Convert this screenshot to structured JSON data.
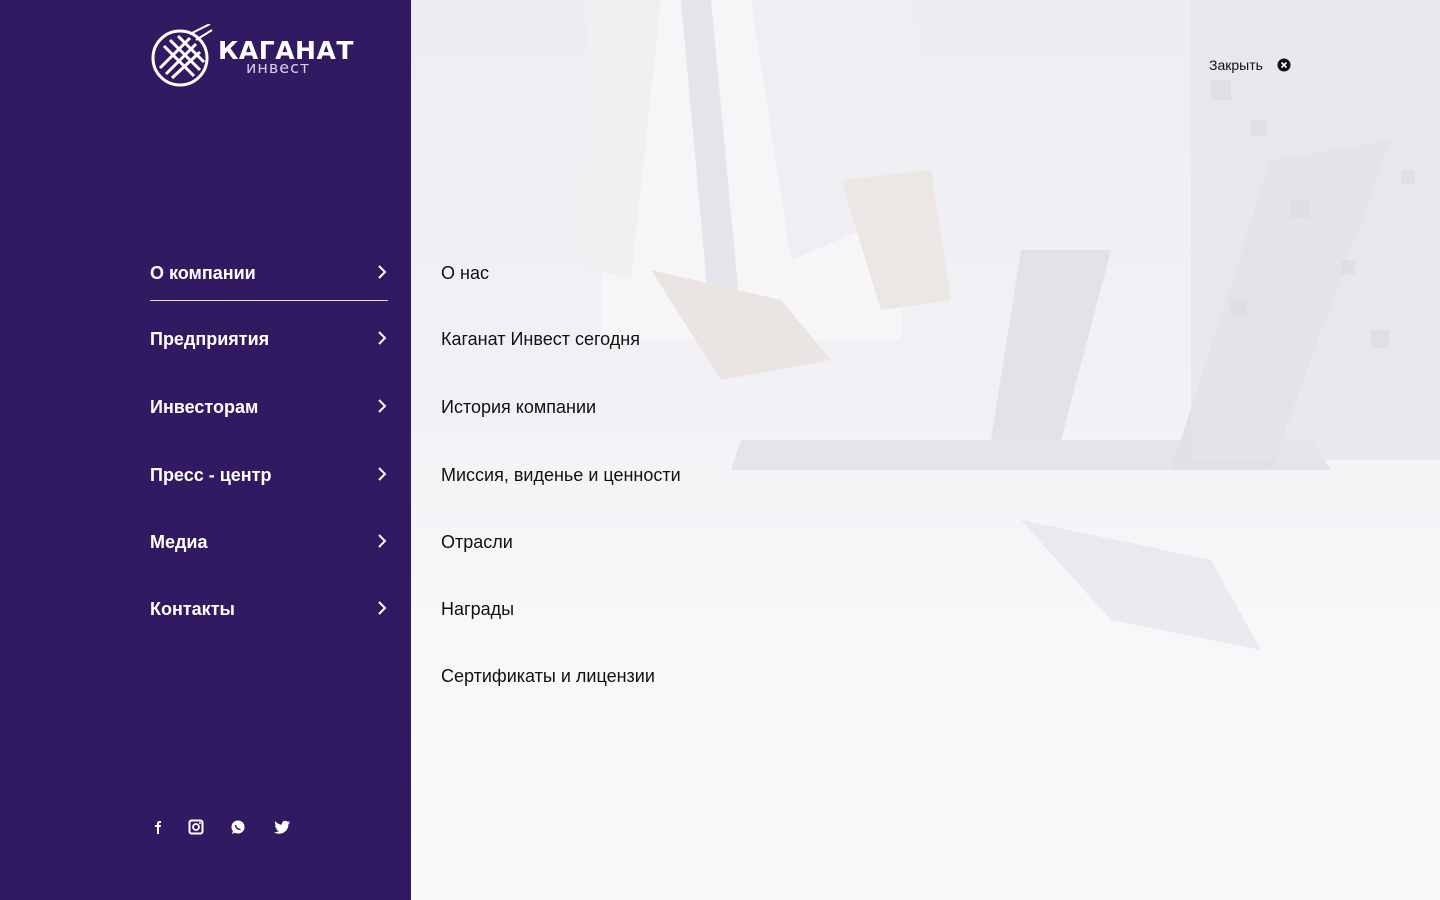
{
  "brand": {
    "name": "КАГАНАТ",
    "tagline": "инвест"
  },
  "main_menu": [
    {
      "label": "О компании",
      "active": true
    },
    {
      "label": "Предприятия"
    },
    {
      "label": "Инвесторам"
    },
    {
      "label": "Пресс - центр"
    },
    {
      "label": "Медиа"
    },
    {
      "label": "Контакты"
    }
  ],
  "submenu": [
    {
      "label": "О нас"
    },
    {
      "label": "Каганат Инвест сегодня"
    },
    {
      "label": "История компании"
    },
    {
      "label": "Миссия, виденье и ценности"
    },
    {
      "label": "Отрасли"
    },
    {
      "label": "Награды"
    },
    {
      "label": "Сертификаты и лицензии"
    }
  ],
  "close_label": "Закрыть",
  "social": [
    {
      "name": "facebook-icon"
    },
    {
      "name": "instagram-icon"
    },
    {
      "name": "whatsapp-icon"
    },
    {
      "name": "twitter-icon"
    }
  ],
  "colors": {
    "sidebar": "#311a61",
    "text_dark": "#111111",
    "text_light": "#ffffff"
  }
}
